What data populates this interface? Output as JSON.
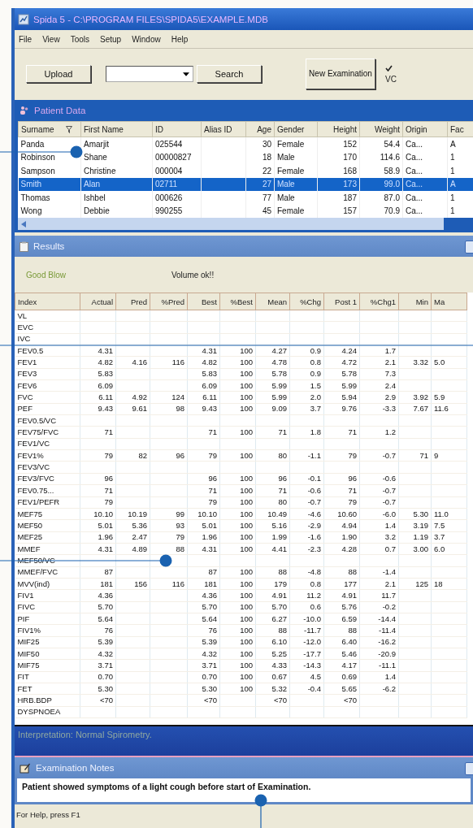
{
  "window": {
    "title": "Spida 5 - C:\\PROGRAM FILES\\SPIDA5\\EXAMPLE.MDB"
  },
  "menu": [
    "File",
    "View",
    "Tools",
    "Setup",
    "Window",
    "Help"
  ],
  "toolbar": {
    "upload": "Upload",
    "search": "Search",
    "new_examination": "New Examination",
    "vc_option": {
      "label": "VC",
      "checked": true
    }
  },
  "patient_panel": {
    "title": "Patient Data",
    "columns": [
      "Surname",
      "First Name",
      "ID",
      "Alias ID",
      "Age",
      "Gender",
      "Height",
      "Weight",
      "Origin",
      "Fac"
    ],
    "rows": [
      {
        "cells": [
          "Panda",
          "Amarjit",
          "025544",
          "",
          "30",
          "Female",
          "152",
          "54.4",
          "Ca...",
          "A"
        ],
        "selected": false
      },
      {
        "cells": [
          "Robinson",
          "Shane",
          "00000827",
          "",
          "18",
          "Male",
          "170",
          "114.6",
          "Ca...",
          "1"
        ],
        "selected": false
      },
      {
        "cells": [
          "Sampson",
          "Christine",
          "000004",
          "",
          "22",
          "Female",
          "168",
          "58.9",
          "Ca...",
          "1"
        ],
        "selected": false
      },
      {
        "cells": [
          "Smith",
          "Alan",
          "02711",
          "",
          "27",
          "Male",
          "173",
          "99.0",
          "Ca...",
          "A"
        ],
        "selected": true
      },
      {
        "cells": [
          "Thomas",
          "Ishbel",
          "000626",
          "",
          "77",
          "Male",
          "187",
          "87.0",
          "Ca...",
          "1"
        ],
        "selected": false
      },
      {
        "cells": [
          "Wong",
          "Debbie",
          "990255",
          "",
          "45",
          "Female",
          "157",
          "70.9",
          "Ca...",
          "1"
        ],
        "selected": false
      }
    ]
  },
  "results_panel": {
    "title": "Results",
    "condition": "Good Blow",
    "message": "Volume ok!!",
    "columns": [
      "Index",
      "Actual",
      "Pred",
      "%Pred",
      "Best",
      "%Best",
      "Mean",
      "%Chg",
      "Post 1",
      "%Chg1",
      "Min",
      "Ma"
    ],
    "rows": [
      [
        "VL"
      ],
      [
        "EVC"
      ],
      [
        "IVC"
      ],
      [
        "FEV0.5",
        "4.31",
        "",
        "",
        "4.31",
        "100",
        "4.27",
        "0.9",
        "4.24",
        "1.7"
      ],
      [
        "FEV1",
        "4.82",
        "4.16",
        "116",
        "4.82",
        "100",
        "4.78",
        "0.8",
        "4.72",
        "2.1",
        "3.32",
        "5.0"
      ],
      [
        "FEV3",
        "5.83",
        "",
        "",
        "5.83",
        "100",
        "5.78",
        "0.9",
        "5.78",
        "7.3"
      ],
      [
        "FEV6",
        "6.09",
        "",
        "",
        "6.09",
        "100",
        "5.99",
        "1.5",
        "5.99",
        "2.4"
      ],
      [
        "FVC",
        "6.11",
        "4.92",
        "124",
        "6.11",
        "100",
        "5.99",
        "2.0",
        "5.94",
        "2.9",
        "3.92",
        "5.9"
      ],
      [
        "PEF",
        "9.43",
        "9.61",
        "98",
        "9.43",
        "100",
        "9.09",
        "3.7",
        "9.76",
        "-3.3",
        "7.67",
        "11.6"
      ],
      [
        "FEV0.5/VC"
      ],
      [
        "FEV75/FVC",
        "71",
        "",
        "",
        "71",
        "100",
        "71",
        "1.8",
        "71",
        "1.2"
      ],
      [
        "FEV1/VC"
      ],
      [
        "FEV1%",
        "79",
        "82",
        "96",
        "79",
        "100",
        "80",
        "-1.1",
        "79",
        "-0.7",
        "71",
        "9"
      ],
      [
        "FEV3/VC"
      ],
      [
        "FEV3/FVC",
        "96",
        "",
        "",
        "96",
        "100",
        "96",
        "-0.1",
        "96",
        "-0.6"
      ],
      [
        "FEV0.75...",
        "71",
        "",
        "",
        "71",
        "100",
        "71",
        "-0.6",
        "71",
        "-0.7"
      ],
      [
        "FEV1/PEFR",
        "79",
        "",
        "",
        "79",
        "100",
        "80",
        "-0.7",
        "79",
        "-0.7"
      ],
      [
        "MEF75",
        "10.10",
        "10.19",
        "99",
        "10.10",
        "100",
        "10.49",
        "-4.6",
        "10.60",
        "-6.0",
        "5.30",
        "11.0"
      ],
      [
        "MEF50",
        "5.01",
        "5.36",
        "93",
        "5.01",
        "100",
        "5.16",
        "-2.9",
        "4.94",
        "1.4",
        "3.19",
        "7.5"
      ],
      [
        "MEF25",
        "1.96",
        "2.47",
        "79",
        "1.96",
        "100",
        "1.99",
        "-1.6",
        "1.90",
        "3.2",
        "1.19",
        "3.7"
      ],
      [
        "MMEF",
        "4.31",
        "4.89",
        "88",
        "4.31",
        "100",
        "4.41",
        "-2.3",
        "4.28",
        "0.7",
        "3.00",
        "6.0"
      ],
      [
        "MEF50/VC"
      ],
      [
        "MMEF/FVC",
        "87",
        "",
        "",
        "87",
        "100",
        "88",
        "-4.8",
        "88",
        "-1.4"
      ],
      [
        "MVV(ind)",
        "181",
        "156",
        "116",
        "181",
        "100",
        "179",
        "0.8",
        "177",
        "2.1",
        "125",
        "18"
      ],
      [
        "FIV1",
        "4.36",
        "",
        "",
        "4.36",
        "100",
        "4.91",
        "11.2",
        "4.91",
        "11.7"
      ],
      [
        "FIVC",
        "5.70",
        "",
        "",
        "5.70",
        "100",
        "5.70",
        "0.6",
        "5.76",
        "-0.2"
      ],
      [
        "PIF",
        "5.64",
        "",
        "",
        "5.64",
        "100",
        "6.27",
        "-10.0",
        "6.59",
        "-14.4"
      ],
      [
        "FIV1%",
        "76",
        "",
        "",
        "76",
        "100",
        "88",
        "-11.7",
        "88",
        "-11.4"
      ],
      [
        "MIF25",
        "5.39",
        "",
        "",
        "5.39",
        "100",
        "6.10",
        "-12.0",
        "6.40",
        "-16.2"
      ],
      [
        "MIF50",
        "4.32",
        "",
        "",
        "4.32",
        "100",
        "5.25",
        "-17.7",
        "5.46",
        "-20.9"
      ],
      [
        "MIF75",
        "3.71",
        "",
        "",
        "3.71",
        "100",
        "4.33",
        "-14.3",
        "4.17",
        "-11.1"
      ],
      [
        "FIT",
        "0.70",
        "",
        "",
        "0.70",
        "100",
        "0.67",
        "4.5",
        "0.69",
        "1.4"
      ],
      [
        "FET",
        "5.30",
        "",
        "",
        "5.30",
        "100",
        "5.32",
        "-0.4",
        "5.65",
        "-6.2"
      ],
      [
        "HRB.BDP",
        "<70",
        "",
        "",
        "<70",
        "",
        "<70",
        "",
        "<70"
      ],
      [
        "DYSPNOEA"
      ]
    ]
  },
  "interpretation": "Interpretation:  Normal Spirometry.",
  "notes_panel": {
    "title": "Examination Notes",
    "text": "Patient showed symptoms of a light cough before start of Examination."
  },
  "status_bar": "For Help, press F1"
}
